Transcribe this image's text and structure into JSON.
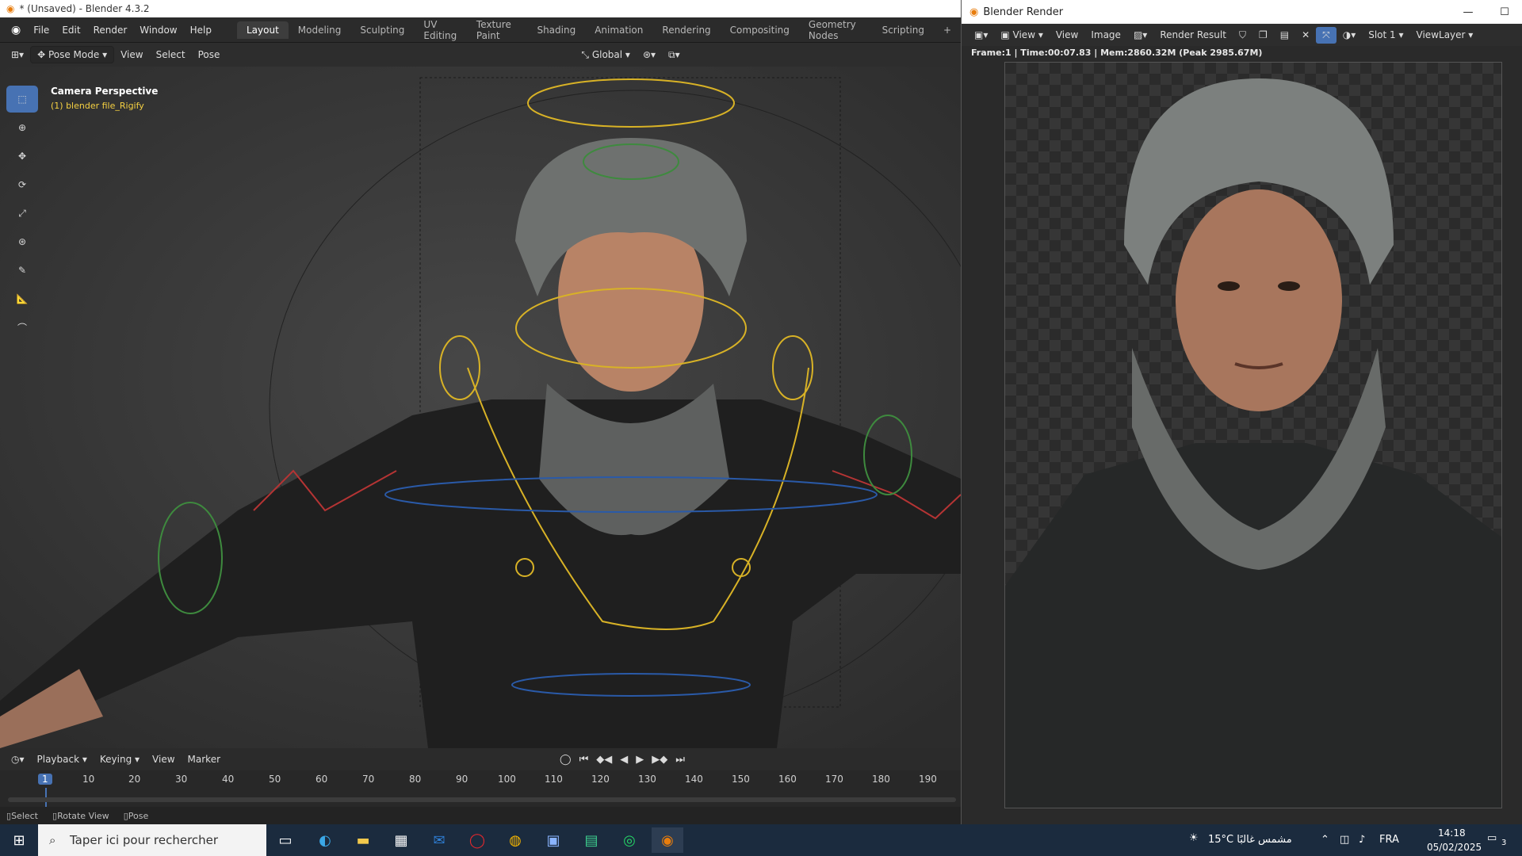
{
  "blender": {
    "title": "* (Unsaved) - Blender 4.3.2",
    "menus": [
      "File",
      "Edit",
      "Render",
      "Window",
      "Help"
    ],
    "workspaces": [
      "Layout",
      "Modeling",
      "Sculpting",
      "UV Editing",
      "Texture Paint",
      "Shading",
      "Animation",
      "Rendering",
      "Compositing",
      "Geometry Nodes",
      "Scripting"
    ],
    "active_workspace": "Layout",
    "header": {
      "mode": "Pose Mode",
      "menus": [
        "View",
        "Select",
        "Pose"
      ],
      "transform_orientation": "Global"
    },
    "viewport": {
      "camera_label": "Camera Perspective",
      "object_label": "(1) blender file_Rigify"
    },
    "timeline": {
      "menus": [
        "Playback",
        "Keying",
        "View",
        "Marker"
      ],
      "current_frame": "1",
      "frame_ticks": [
        "10",
        "20",
        "30",
        "40",
        "50",
        "60",
        "70",
        "80",
        "90",
        "100",
        "110",
        "120",
        "130",
        "140",
        "150",
        "160",
        "170",
        "180",
        "190"
      ]
    },
    "statusbar": {
      "items": [
        "Select",
        "Rotate View",
        "Pose"
      ]
    }
  },
  "render": {
    "title": "Blender Render",
    "header": {
      "view_menu": "View",
      "menus": [
        "View",
        "Image"
      ],
      "image": "Render Result",
      "slot": "Slot 1",
      "view_layer": "ViewLayer"
    },
    "info": "Frame:1 | Time:00:07.83 | Mem:2860.32M (Peak 2985.67M)"
  },
  "taskbar": {
    "search_placeholder": "Taper ici pour rechercher",
    "weather": "15°C مشمس غالبًا",
    "language": "FRA",
    "time": "14:18",
    "date": "05/02/2025",
    "notifications": "3"
  }
}
